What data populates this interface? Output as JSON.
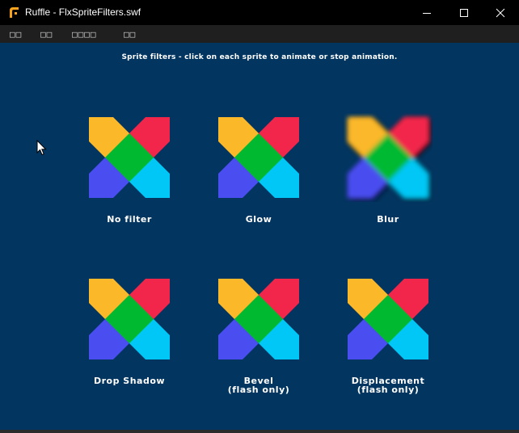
{
  "window": {
    "title": "Ruffle - FlxSpriteFilters.swf",
    "controls": [
      "minimize",
      "maximize",
      "close"
    ]
  },
  "menu": {
    "items": [
      "□□",
      "□□",
      "□□□□",
      "□□"
    ]
  },
  "stage": {
    "background": "#023560",
    "instructions": "Sprite filters - click on each sprite to animate or stop animation.",
    "sprites": [
      {
        "label": "No filter",
        "label2": "",
        "filter": "none"
      },
      {
        "label": "Glow",
        "label2": "",
        "filter": "glow"
      },
      {
        "label": "Blur",
        "label2": "",
        "filter": "blur"
      },
      {
        "label": "Drop Shadow",
        "label2": "",
        "filter": "drop-shadow"
      },
      {
        "label": "Bevel",
        "label2": "(flash only)",
        "filter": "bevel"
      },
      {
        "label": "Displacement",
        "label2": "(flash only)",
        "filter": "displacement"
      }
    ],
    "sprite_colors": {
      "top_left": "#fbb829",
      "top_right": "#f2264b",
      "center": "#00b930",
      "bottom_left": "#4a4df0",
      "bottom_right": "#00c7f5"
    }
  }
}
